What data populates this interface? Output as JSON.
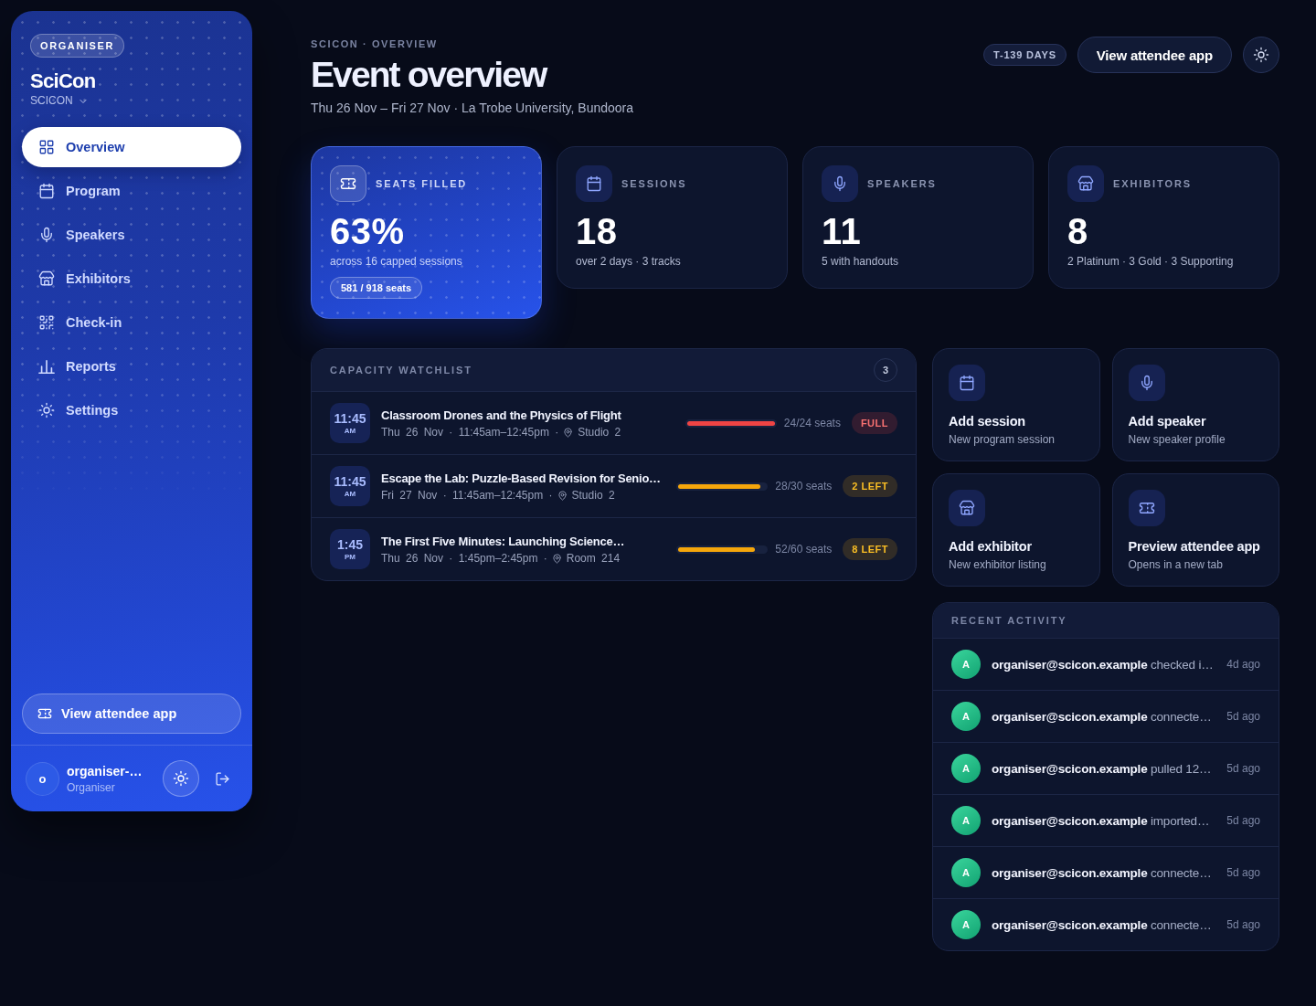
{
  "sidebar": {
    "role_badge": "ORGANISER",
    "brand": "SciCon",
    "workspace": "SCICON",
    "nav": [
      {
        "label": "Overview",
        "selected": true
      },
      {
        "label": "Program",
        "selected": false
      },
      {
        "label": "Speakers",
        "selected": false
      },
      {
        "label": "Exhibitors",
        "selected": false
      },
      {
        "label": "Check-in",
        "selected": false
      },
      {
        "label": "Reports",
        "selected": false
      },
      {
        "label": "Settings",
        "selected": false
      }
    ],
    "attendee_button": "View attendee app",
    "user": {
      "initial": "o",
      "name": "organiser-…",
      "role": "Organiser"
    }
  },
  "header": {
    "breadcrumb": "SCICON · OVERVIEW",
    "title": "Event overview",
    "subtitle": "Thu 26 Nov – Fri 27 Nov · La Trobe University, Bundoora",
    "countdown": "T-139 DAYS",
    "action_button": "View attendee app"
  },
  "stats": [
    {
      "kind": "highlight",
      "label": "SEATS FILLED",
      "value": "63%",
      "detail": "across 16 capped sessions",
      "pill": "581 / 918 seats"
    },
    {
      "kind": "plain",
      "label": "SESSIONS",
      "value": "18",
      "detail": "over 2 days · 3 tracks"
    },
    {
      "kind": "plain",
      "label": "SPEAKERS",
      "value": "11",
      "detail": "5 with handouts"
    },
    {
      "kind": "plain",
      "label": "EXHIBITORS",
      "value": "8",
      "detail": "2 Platinum · 3 Gold · 3 Supporting"
    }
  ],
  "watchlist": {
    "title": "CAPACITY WATCHLIST",
    "count": "3",
    "rows": [
      {
        "kind": "critical",
        "time": "11:45",
        "meridiem": "AM",
        "title": "Classroom Drones and the Physics of Flight",
        "when": "Thu 26 Nov · 11:45am–12:45pm ·",
        "room": "Studio 2",
        "level": 1,
        "seats": "24/24 seats",
        "badge": "FULL"
      },
      {
        "kind": "warning",
        "time": "11:45",
        "meridiem": "AM",
        "title": "Escape the Lab: Puzzle-Based Revision for Senio…",
        "when": "Fri 27 Nov · 11:45am–12:45pm ·",
        "room": "Studio 2",
        "level": 0.93,
        "seats": "28/30 seats",
        "badge": "2 LEFT"
      },
      {
        "kind": "warning",
        "time": "1:45",
        "meridiem": "PM",
        "title": "The First Five Minutes: Launching Science…",
        "when": "Thu 26 Nov · 1:45pm–2:45pm ·",
        "room": "Room 214",
        "level": 0.87,
        "seats": "52/60 seats",
        "badge": "8 LEFT"
      }
    ]
  },
  "quick_actions": [
    {
      "title": "Add session",
      "subtitle": "New program session"
    },
    {
      "title": "Add speaker",
      "subtitle": "New speaker profile"
    },
    {
      "title": "Add exhibitor",
      "subtitle": "New exhibitor listing"
    },
    {
      "title": "Preview attendee app",
      "subtitle": "Opens in a new tab"
    }
  ],
  "recent_activity": {
    "title": "RECENT ACTIVITY",
    "items": [
      {
        "initial": "A",
        "text": "**organiser@scicon.example** checked i…",
        "time": "4d ago"
      },
      {
        "initial": "A",
        "text": "**organiser@scicon.example** connecte…",
        "time": "5d ago"
      },
      {
        "initial": "A",
        "text": "**organiser@scicon.example** pulled 12…",
        "time": "5d ago"
      },
      {
        "initial": "A",
        "text": "**organiser@scicon.example** imported…",
        "time": "5d ago"
      },
      {
        "initial": "A",
        "text": "**organiser@scicon.example** connecte…",
        "time": "5d ago"
      },
      {
        "initial": "A",
        "text": "**organiser@scicon.example** connecte…",
        "time": "5d ago"
      }
    ]
  }
}
